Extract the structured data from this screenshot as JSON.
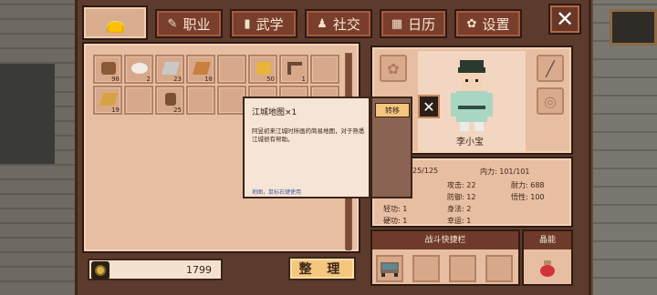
{
  "tabs": {
    "bag_icon": "bag-icon",
    "items": [
      {
        "label": "职业",
        "icon": "brush-icon"
      },
      {
        "label": "武学",
        "icon": "book-icon"
      },
      {
        "label": "社交",
        "icon": "people-icon"
      },
      {
        "label": "日历",
        "icon": "calendar-icon"
      },
      {
        "label": "设置",
        "icon": "gear-icon"
      }
    ]
  },
  "inventory": {
    "slots": [
      {
        "count": "98",
        "icon": "wood-icon"
      },
      {
        "count": "2",
        "icon": "plate-icon"
      },
      {
        "count": "23",
        "icon": "iron-ingot-icon"
      },
      {
        "count": "18",
        "icon": "copper-ingot-icon"
      },
      {
        "count": "",
        "icon": ""
      },
      {
        "count": "50",
        "icon": "cheese-icon"
      },
      {
        "count": "1",
        "icon": "hook-icon"
      },
      {
        "count": "",
        "icon": ""
      },
      {
        "count": "19",
        "icon": "gold-bar-icon"
      },
      {
        "count": "",
        "icon": ""
      },
      {
        "count": "25",
        "icon": "log-icon"
      }
    ],
    "coins": "1799",
    "sort_label": "整 理"
  },
  "character": {
    "name": "李小宝",
    "stats": {
      "hp": "25/125",
      "internal_power": "内力: 101/101",
      "attack": "攻击: 22",
      "endurance": "耐力: 688",
      "defense": "防御: 12",
      "wisdom": "悟性: 100",
      "qinggong": "轻功: 1",
      "body": "身法: 2",
      "hard_skill": "硬功: 1",
      "luck": "幸运: 1"
    }
  },
  "battle_bar": {
    "title": "战斗快捷栏"
  },
  "crystal": {
    "title": "晶能"
  },
  "tooltip": {
    "title": "江城地图×1",
    "description": "阿昱初来江城时所画的简易地图，对于熟悉江城很有帮助。",
    "hint": "地图，鼠标右键使用",
    "transfer": "转移"
  },
  "colors": {
    "frame": "#5c3b2c",
    "panel": "#e8bea2",
    "tab": "#7a3e2d",
    "button": "#f4c67e"
  }
}
